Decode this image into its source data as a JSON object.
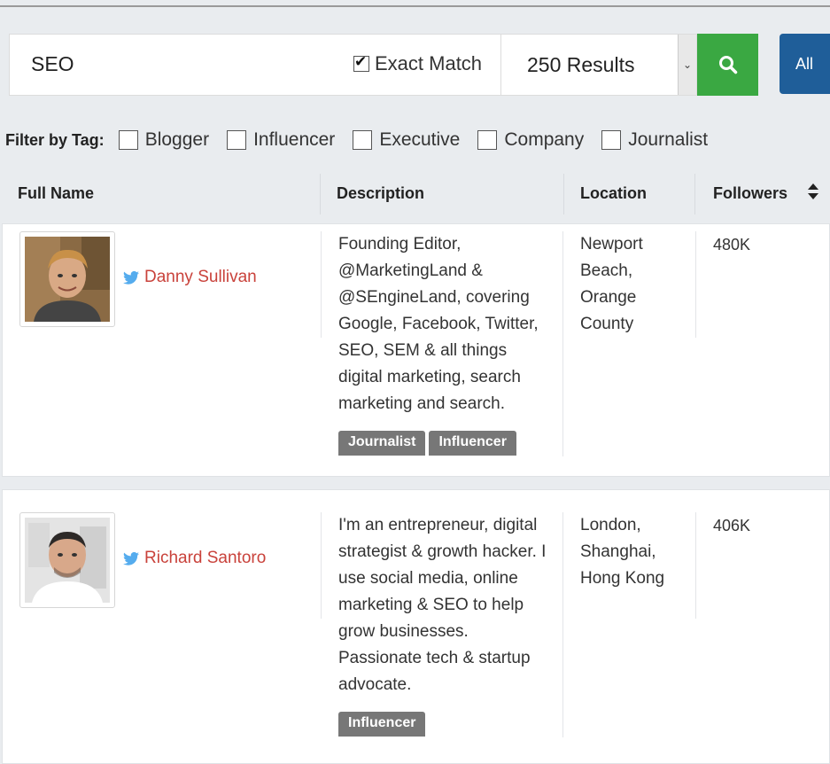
{
  "search": {
    "query": "SEO",
    "exact_match_label": "Exact Match",
    "exact_match_checked": true
  },
  "results_select": {
    "selected": "250 Results"
  },
  "buttons": {
    "all_label": "All"
  },
  "filter": {
    "label": "Filter by Tag:",
    "tags": [
      "Blogger",
      "Influencer",
      "Executive",
      "Company",
      "Journalist"
    ]
  },
  "table": {
    "headers": [
      "Full Name",
      "Description",
      "Location",
      "Followers"
    ],
    "rows": [
      {
        "name": "Danny Sullivan",
        "description": "Founding Editor, @MarketingLand & @SEngineLand, covering Google, Facebook, Twitter, SEO, SEM & all things digital marketing, search marketing and search.",
        "location": "Newport Beach, Orange County",
        "followers": "480K",
        "tags": [
          "Journalist",
          "Influencer"
        ]
      },
      {
        "name": "Richard Santoro",
        "description": "I'm an entrepreneur, digital strategist & growth hacker. I use social media, online marketing & SEO to help grow businesses. Passionate tech & startup advocate.",
        "location": "London, Shanghai, Hong Kong",
        "followers": "406K",
        "tags": [
          "Influencer"
        ]
      }
    ]
  },
  "colors": {
    "name_link": "#c9423b",
    "search_button": "#3aa842",
    "all_button": "#1f5e99",
    "twitter": "#55acee",
    "tag_badge": "#777777"
  },
  "icons": {
    "search_button": "search-icon",
    "sort": "sort-icon",
    "row_name": "twitter-icon",
    "select": "chevron-down-icon"
  }
}
